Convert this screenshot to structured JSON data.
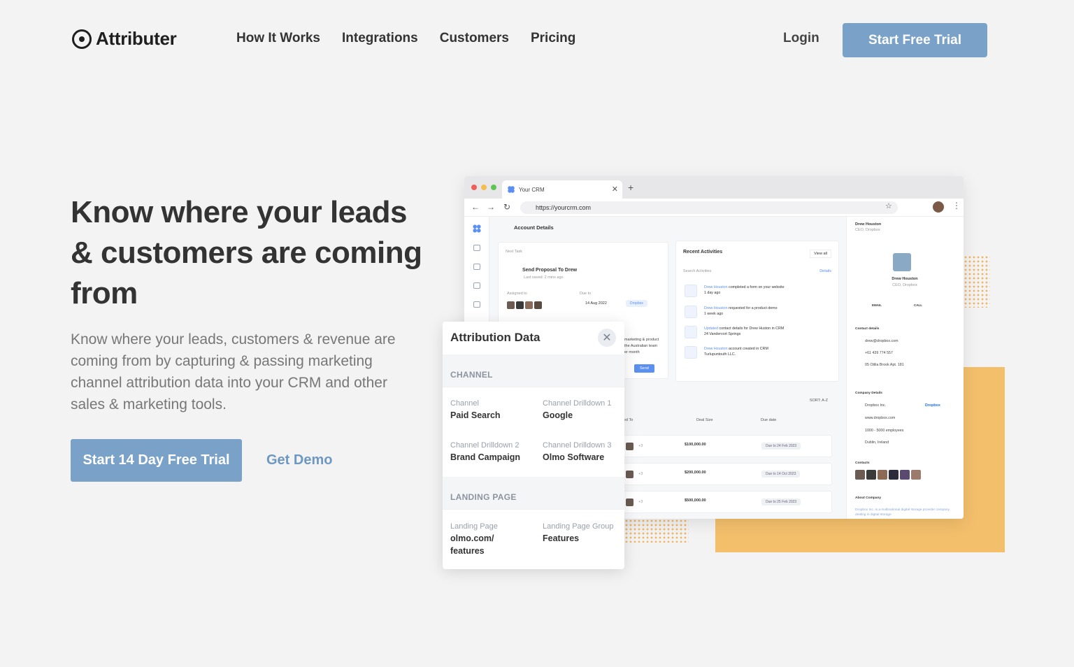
{
  "brand": {
    "name": "Attributer"
  },
  "nav": {
    "links": [
      "How It Works",
      "Integrations",
      "Customers",
      "Pricing"
    ],
    "login": "Login",
    "cta": "Start Free Trial"
  },
  "hero": {
    "title": "Know where your leads & customers are coming from",
    "subtitle": "Know where your leads, customers & revenue are coming from by capturing & passing marketing channel attribution data into your CRM and other sales & marketing tools.",
    "cta_primary": "Start 14 Day Free Trial",
    "cta_secondary": "Get Demo"
  },
  "colors": {
    "accent": "#7aa1c7",
    "orange": "#f3bf6b",
    "crm_blue": "#5b8ff0"
  },
  "crm": {
    "tab_title": "Your CRM",
    "url": "https://yourcrm.com",
    "account_header": "Account Details",
    "next_task": {
      "label": "Next Task",
      "title": "Send Proposal To Drew",
      "saved": "Last saved: 2 mins ago",
      "assigned_label": "Assigned to",
      "due_label": "Due to",
      "due_date": "14 Aug 2022",
      "tag": "Dropbox",
      "note_lines": [
        "marketing & product",
        "the Australian team",
        "er month"
      ],
      "send": "Send"
    },
    "recent": {
      "title": "Recent Activities",
      "view_all": "View all",
      "search_label": "Search Activities",
      "details": "Details",
      "items": [
        {
          "who": "Drew Houston",
          "text": "completed a form on your website",
          "when": "1 day ago"
        },
        {
          "who": "Drew Houston",
          "text": "requested for a product demo",
          "when": "1 week ago"
        },
        {
          "who": "Updated",
          "text": "contact details for Drew Huston in CRM",
          "when": "24 Vandervort Springs"
        },
        {
          "who": "Drew Houston",
          "text": "account created in CRM",
          "when": "Turlupuntouth LLC."
        }
      ]
    },
    "deals": {
      "sort": "SORT: A-Z",
      "headers": [
        "ed To",
        "Deal Size",
        "Due date"
      ],
      "rows": [
        {
          "extra": "+3",
          "size": "$100,000.00",
          "due": "Due to 24 Feb 2023"
        },
        {
          "extra": "+3",
          "size": "$200,000.00",
          "due": "Due to 14 Oct 2023"
        },
        {
          "extra": "+3",
          "size": "$500,000.00",
          "due": "Due to 25 Feb 2023"
        }
      ]
    },
    "contact": {
      "name": "Drew Houston",
      "role": "CEO, Dropbox",
      "email_btn": "EMAIL",
      "call_btn": "CALL",
      "details_title": "Contact details",
      "email": "drew@dropbox.com",
      "phone": "+61 439 774 557",
      "address": "05 Otilia Brook Apt. 181",
      "company_title": "Company Details",
      "company": "Dropbox Inc.",
      "company_logo": "Dropbox",
      "website": "www.dropbox.com",
      "employees": "1000 - 5000 employees",
      "location": "Dublin, Ireland",
      "contacts_title": "Contacts",
      "about_title": "About Company",
      "about_text": "Dropbox Inc. is a multinational digital storage provider company, dealing in digital storage"
    }
  },
  "attribution": {
    "title": "Attribution Data",
    "section_channel": "CHANNEL",
    "channel_label": "Channel",
    "channel_value": "Paid Search",
    "drill1_label": "Channel Drilldown 1",
    "drill1_value": "Google",
    "drill2_label": "Channel Drilldown 2",
    "drill2_value": "Brand Campaign",
    "drill3_label": "Channel Drilldown 3",
    "drill3_value": "Olmo Software",
    "section_landing": "LANDING PAGE",
    "landing_label": "Landing Page",
    "landing_value": "olmo.com/ features",
    "landing_group_label": "Landing Page Group",
    "landing_group_value": "Features"
  }
}
